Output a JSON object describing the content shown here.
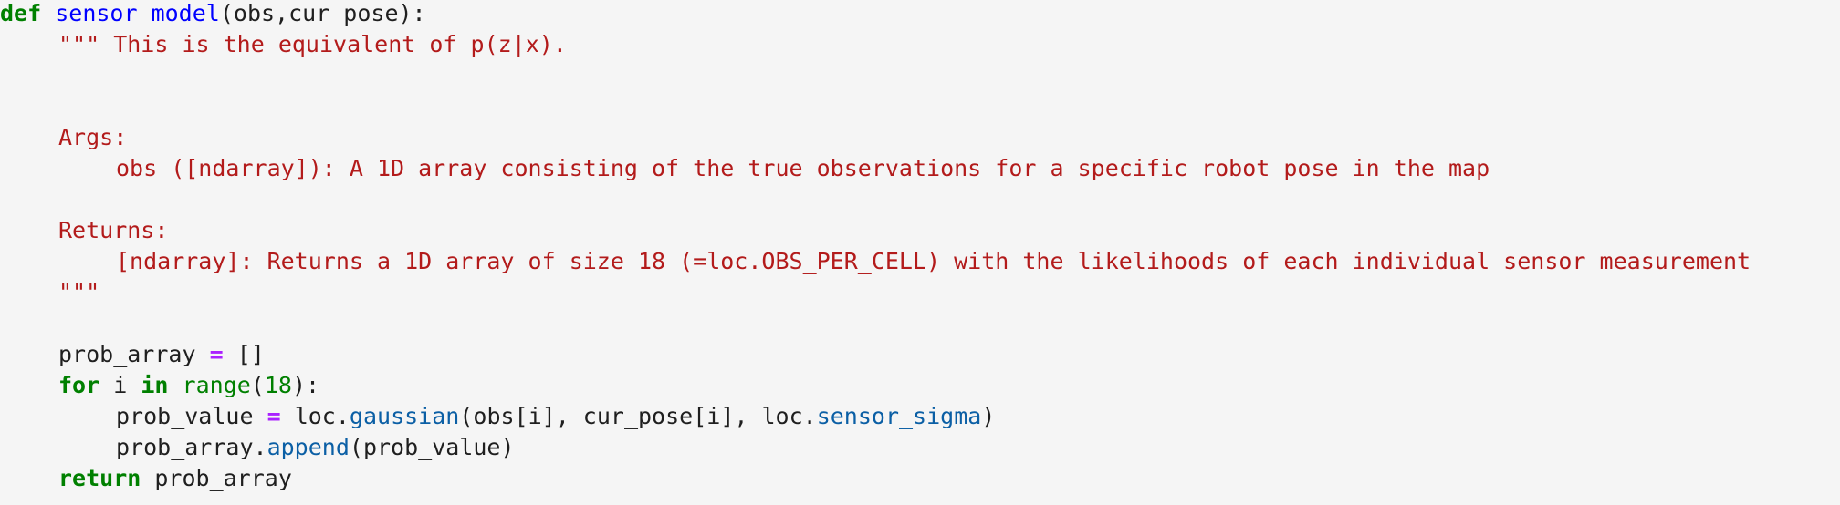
{
  "code": {
    "line1": {
      "kw_def": "def",
      "func_name": "sensor_model",
      "params": "(obs,cur_pose):"
    },
    "docstring": {
      "line1": "\"\"\" This is the equivalent of p(z|x).",
      "args_header": "Args:",
      "args_obs": "obs ([ndarray]): A 1D array consisting of the true observations for a specific robot pose in the map",
      "returns_header": "Returns:",
      "returns_desc": "[ndarray]: Returns a 1D array of size 18 (=loc.OBS_PER_CELL) with the likelihoods of each individual sensor measurement",
      "close": "\"\"\""
    },
    "assign_line": {
      "var": "prob_array",
      "op": "=",
      "value": "[]"
    },
    "for_line": {
      "kw_for": "for",
      "var": "i",
      "kw_in": "in",
      "builtin": "range",
      "open": "(",
      "num": "18",
      "close": "):"
    },
    "prob_value_line": {
      "var": "prob_value",
      "op": "=",
      "obj": "loc.",
      "method": "gaussian",
      "args": "(obs[i], cur_pose[i], loc.",
      "attr": "sensor_sigma",
      "close": ")"
    },
    "append_line": {
      "obj": "prob_array.",
      "method": "append",
      "args": "(prob_value)"
    },
    "return_line": {
      "kw_return": "return",
      "value": "prob_array"
    }
  }
}
